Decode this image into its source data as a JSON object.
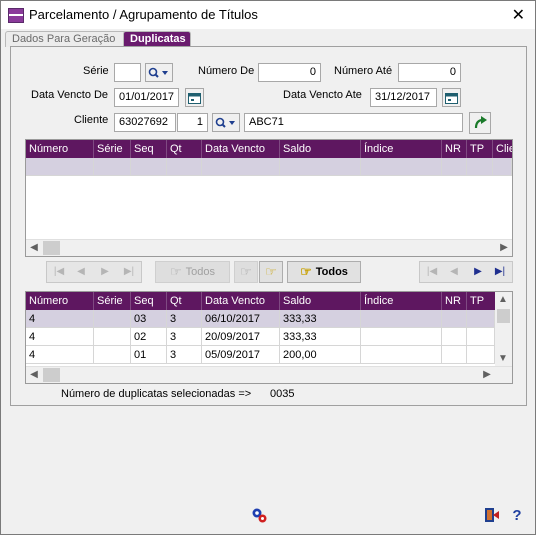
{
  "window": {
    "title": "Parcelamento / Agrupamento de Títulos",
    "close": "✕"
  },
  "tabs": [
    {
      "label": "Dados Para Geração",
      "active": false
    },
    {
      "label": "Duplicatas",
      "active": true
    }
  ],
  "filters": {
    "serie_label": "Série",
    "serie_value": "",
    "numero_de_label": "Número De",
    "numero_de_value": "0",
    "numero_ate_label": "Número Até",
    "numero_ate_value": "0",
    "data_vencto_de_label": "Data Vencto De",
    "data_vencto_de_value": "01/01/2017",
    "data_vencto_ate_label": "Data Vencto Ate",
    "data_vencto_ate_value": "31/12/2017",
    "cliente_label": "Cliente",
    "cliente_code": "63027692",
    "cliente_seq": "1",
    "cliente_name": "ABC71"
  },
  "upper_grid": {
    "columns": [
      "Número",
      "Série",
      "Seq",
      "Qt",
      "Data Vencto",
      "Saldo",
      "Índice",
      "NR",
      "TP",
      "Clie"
    ]
  },
  "nav_buttons": {
    "todos_disabled_label": "Todos",
    "todos_label": "Todos"
  },
  "lower_grid": {
    "columns": [
      "Número",
      "Série",
      "Seq",
      "Qt",
      "Data Vencto",
      "Saldo",
      "Índice",
      "NR",
      "TP"
    ],
    "rows": [
      [
        "4",
        "",
        "03",
        "3",
        "06/10/2017",
        "333,33",
        "",
        "",
        ""
      ],
      [
        "4",
        "",
        "02",
        "3",
        "20/09/2017",
        "333,33",
        "",
        "",
        ""
      ],
      [
        "4",
        "",
        "01",
        "3",
        "05/09/2017",
        "200,00",
        "",
        "",
        ""
      ]
    ]
  },
  "summary": {
    "label": "Número de duplicatas selecionadas =>",
    "count": "0035"
  },
  "colors": {
    "header_purple": "#5e1760",
    "tab_active": "#6a1b6e",
    "selected_row": "#d5d0e0"
  }
}
